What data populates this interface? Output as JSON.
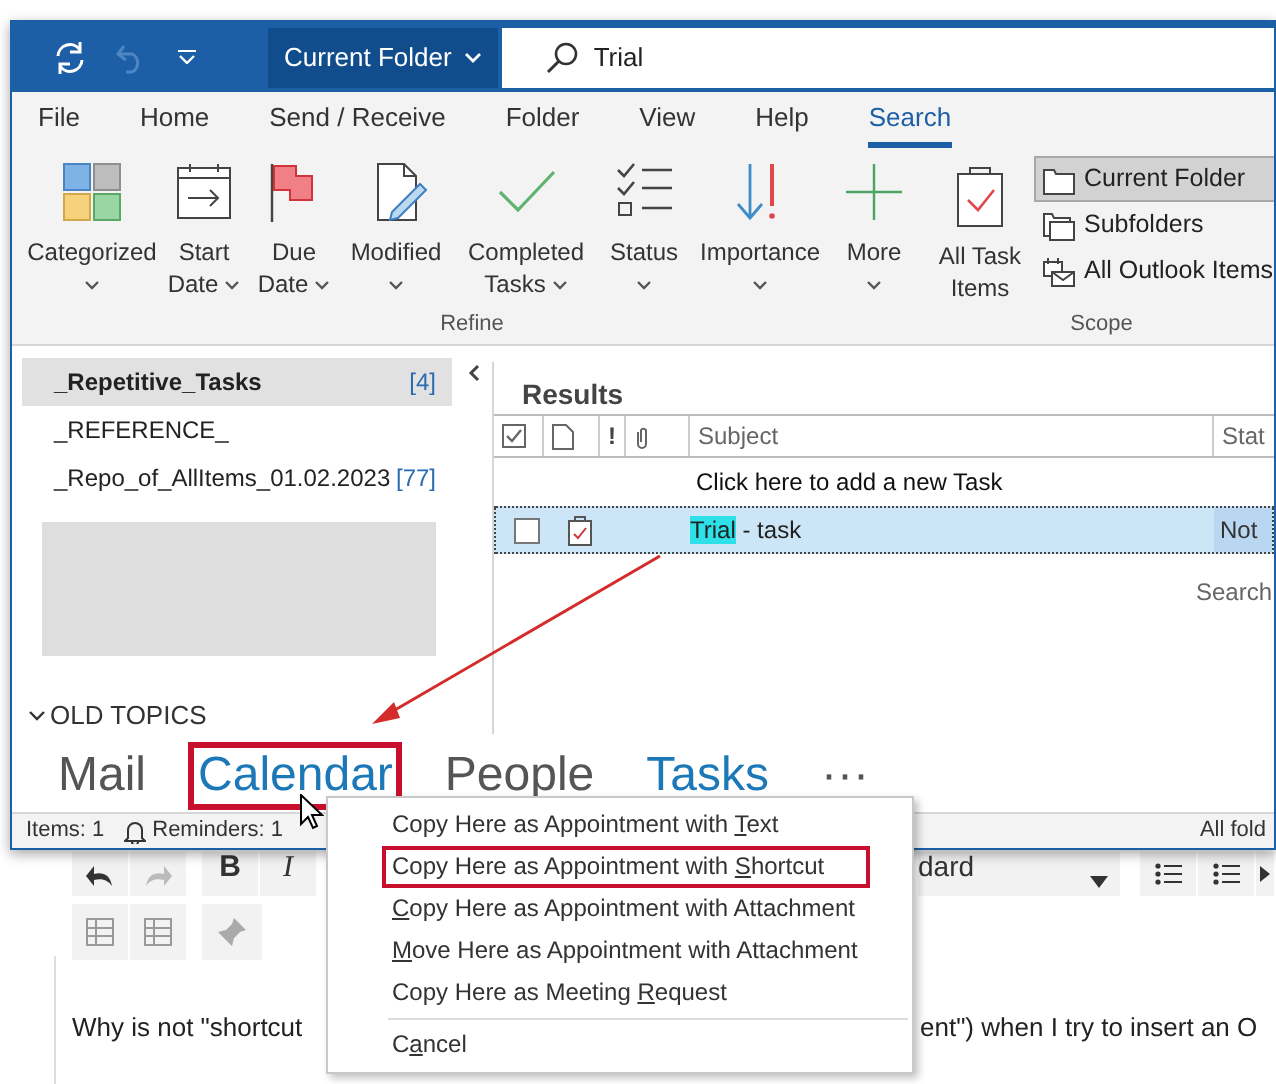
{
  "window": {
    "scope_dropdown": "Current Folder",
    "search": {
      "value": "Trial"
    }
  },
  "ribbon": {
    "tabs": [
      {
        "label": "File",
        "selected": false
      },
      {
        "label": "Home",
        "selected": false
      },
      {
        "label": "Send / Receive",
        "selected": false
      },
      {
        "label": "Folder",
        "selected": false
      },
      {
        "label": "View",
        "selected": false
      },
      {
        "label": "Help",
        "selected": false
      },
      {
        "label": "Search",
        "selected": true
      }
    ],
    "refine": {
      "label": "Refine",
      "buttons": [
        {
          "kind": "categorized",
          "lines": [
            "Categorized"
          ],
          "dropdown": true
        },
        {
          "kind": "start_date",
          "lines": [
            "Start",
            "Date"
          ],
          "dropdown": true
        },
        {
          "kind": "due_date",
          "lines": [
            "Due",
            "Date"
          ],
          "dropdown": true
        },
        {
          "kind": "modified",
          "lines": [
            "Modified"
          ],
          "dropdown": true
        },
        {
          "kind": "completed",
          "lines": [
            "Completed",
            "Tasks"
          ],
          "dropdown": true
        },
        {
          "kind": "status",
          "lines": [
            "Status"
          ],
          "dropdown": true
        },
        {
          "kind": "importance",
          "lines": [
            "Importance"
          ],
          "dropdown": true
        },
        {
          "kind": "more",
          "lines": [
            "More"
          ],
          "dropdown": true
        }
      ]
    },
    "scope": {
      "label": "Scope",
      "large_button": {
        "lines": [
          "All Task",
          "Items"
        ]
      },
      "options": [
        {
          "kind": "folder",
          "label": "Current Folder",
          "selected": true
        },
        {
          "kind": "subfolders",
          "label": "Subfolders",
          "selected": false
        },
        {
          "kind": "all_items",
          "label": "All Outlook Items",
          "selected": false
        }
      ]
    }
  },
  "folders": [
    {
      "name": "_Repetitive_Tasks",
      "count": "[4]",
      "selected": true
    },
    {
      "name": "_REFERENCE_",
      "selected": false
    },
    {
      "name": "_Repo_of_AllItems_01.02.2023",
      "count": "[77]",
      "selected": false
    }
  ],
  "folder_group": {
    "label": "OLD TOPICS",
    "expanded": true
  },
  "results": {
    "title": "Results",
    "columns": [
      {
        "kind": "check"
      },
      {
        "kind": "type"
      },
      {
        "kind": "importance",
        "label": "!"
      },
      {
        "kind": "attachment"
      },
      {
        "kind": "text",
        "label": "Subject"
      },
      {
        "kind": "text",
        "label": "Stat"
      }
    ],
    "new_task_prompt": "Click here to add a new Task",
    "rows": [
      {
        "subject_match": "Trial",
        "subject_rest": " - task",
        "status": "Not",
        "selected": true,
        "checked": false
      }
    ],
    "search_hint": "Search"
  },
  "nav": [
    {
      "label": "Mail",
      "highlighted": false,
      "annotated": false
    },
    {
      "label": "Calendar",
      "highlighted": true,
      "annotated": true
    },
    {
      "label": "People",
      "highlighted": false,
      "annotated": false
    },
    {
      "label": "Tasks",
      "highlighted": true,
      "annotated": false
    },
    {
      "label": "···",
      "highlighted": false,
      "annotated": false
    }
  ],
  "status_bar": {
    "items": "Items: 1",
    "reminders": "Reminders: 1",
    "right": "All fold"
  },
  "context_menu": [
    {
      "before": "Copy Here as Appointment with ",
      "key": "T",
      "after": "ext",
      "annotated": false,
      "separator_before": false
    },
    {
      "before": "Copy Here as Appointment with ",
      "key": "S",
      "after": "hortcut",
      "annotated": true,
      "separator_before": false
    },
    {
      "key": "C",
      "after": "opy Here as Appointment with Attachment",
      "annotated": false,
      "separator_before": false
    },
    {
      "key": "M",
      "after": "ove Here as Appointment with Attachment",
      "annotated": false,
      "separator_before": false
    },
    {
      "before": "Copy Here as Meeting ",
      "key": "R",
      "after": "equest",
      "annotated": false,
      "separator_before": false
    },
    {
      "before": "C",
      "key": "a",
      "after": "ncel",
      "annotated": false,
      "separator_before": true
    }
  ],
  "background_page": {
    "format_buttons": [
      "B",
      "I"
    ],
    "style_dropdown": "dard",
    "text_fragments": [
      "Why is not \"shortcut",
      "ent\") when I try to insert an O"
    ]
  }
}
